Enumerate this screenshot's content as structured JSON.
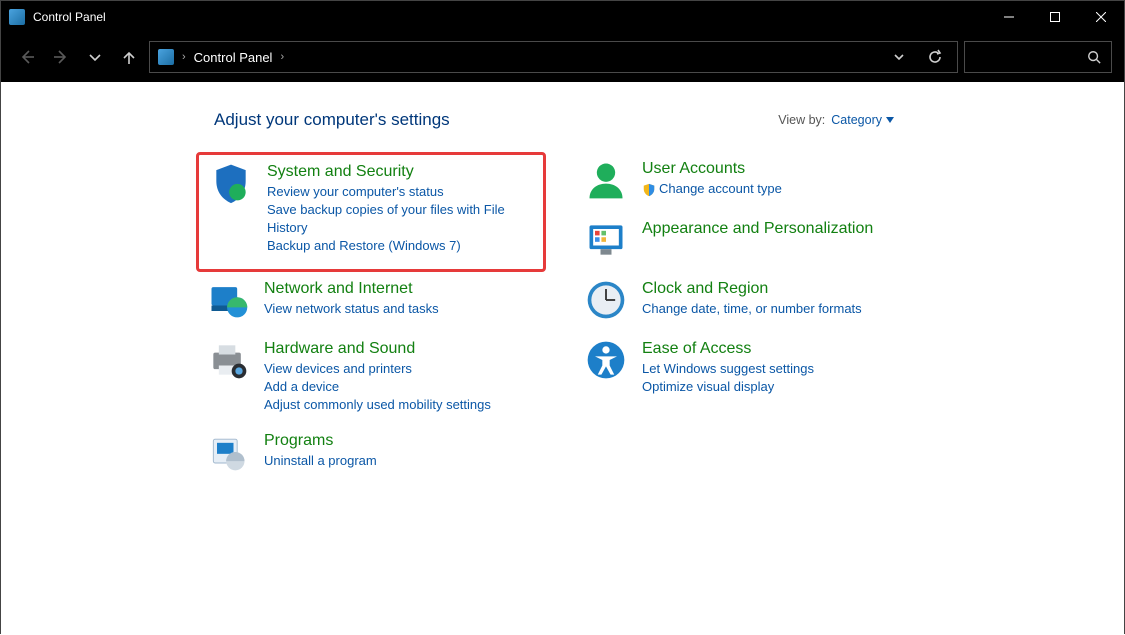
{
  "window": {
    "title": "Control Panel"
  },
  "breadcrumb": {
    "root": "Control Panel"
  },
  "header": {
    "title": "Adjust your computer's settings",
    "viewby_label": "View by:",
    "viewby_value": "Category"
  },
  "left": [
    {
      "title": "System and Security",
      "links": [
        "Review your computer's status",
        "Save backup copies of your files with File History",
        "Backup and Restore (Windows 7)"
      ],
      "highlight": true,
      "icon": "shield"
    },
    {
      "title": "Network and Internet",
      "links": [
        "View network status and tasks"
      ],
      "icon": "globe"
    },
    {
      "title": "Hardware and Sound",
      "links": [
        "View devices and printers",
        "Add a device",
        "Adjust commonly used mobility settings"
      ],
      "icon": "printer"
    },
    {
      "title": "Programs",
      "links": [
        "Uninstall a program"
      ],
      "icon": "programs"
    }
  ],
  "right": [
    {
      "title": "User Accounts",
      "links": [
        "Change account type"
      ],
      "shielded": [
        true
      ],
      "icon": "user"
    },
    {
      "title": "Appearance and Personalization",
      "links": [],
      "icon": "appearance"
    },
    {
      "title": "Clock and Region",
      "links": [
        "Change date, time, or number formats"
      ],
      "icon": "clock"
    },
    {
      "title": "Ease of Access",
      "links": [
        "Let Windows suggest settings",
        "Optimize visual display"
      ],
      "icon": "accessibility"
    }
  ]
}
